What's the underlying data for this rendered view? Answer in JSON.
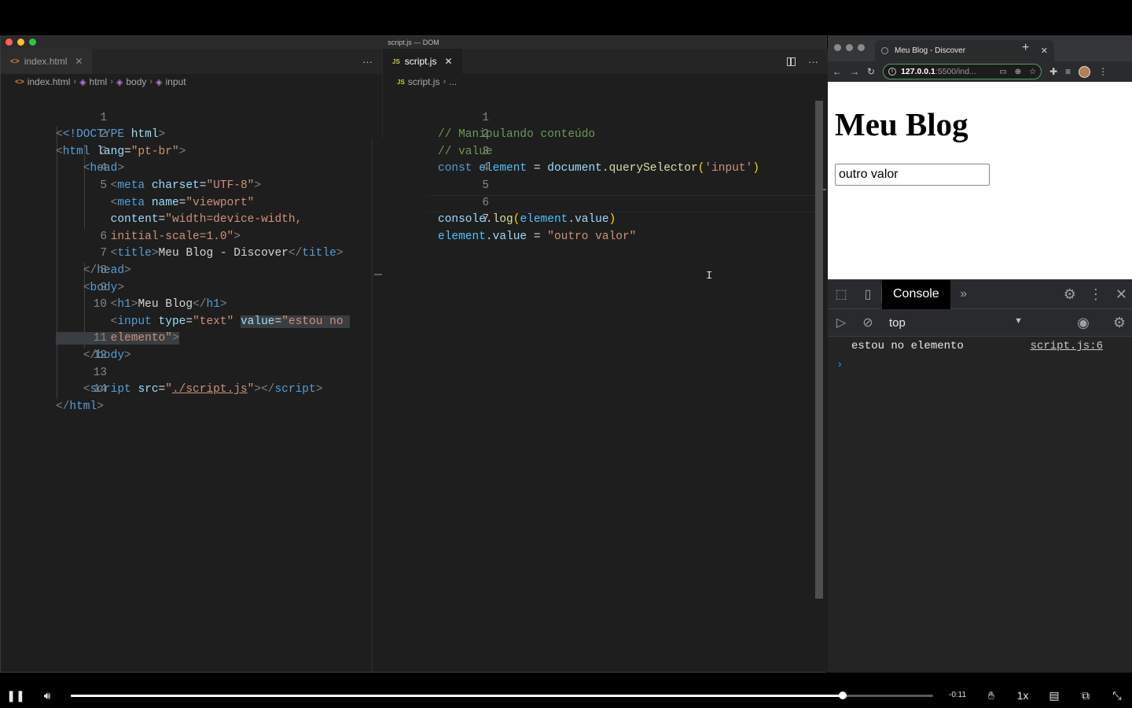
{
  "vscode": {
    "window_title": "script.js — DOM",
    "left": {
      "tab": {
        "icon": "<>",
        "label": "index.html"
      },
      "more": "···",
      "breadcrumb": [
        "index.html",
        "html",
        "body",
        "input"
      ],
      "lines": [
        {
          "n": "1"
        },
        {
          "n": "2"
        },
        {
          "n": "3"
        },
        {
          "n": "4"
        },
        {
          "n": "5"
        },
        {
          "n": ""
        },
        {
          "n": ""
        },
        {
          "n": "6"
        },
        {
          "n": "7"
        },
        {
          "n": "8"
        },
        {
          "n": "9"
        },
        {
          "n": "10"
        },
        {
          "n": ""
        },
        {
          "n": "11"
        },
        {
          "n": "12"
        },
        {
          "n": "13"
        },
        {
          "n": "14"
        }
      ],
      "code": {
        "doctype": "<!DOCTYPE",
        "html_word": "html",
        "gt": ">",
        "html_open": "html",
        "lang_attr": "lang",
        "lang_val": "\"pt-br\"",
        "head_open": "head",
        "meta": "meta",
        "charset_attr": "charset",
        "charset_val": "\"UTF-8\"",
        "name_attr": "name",
        "name_val": "\"viewport\"",
        "content_attr": "content",
        "content_val1": "\"width=device-width,",
        "content_val2": "initial-scale=1.0\"",
        "title": "title",
        "title_text": "Meu Blog - Discover",
        "head_close": "head",
        "body_open": "body",
        "h1": "h1",
        "h1_text": "Meu Blog",
        "input": "input",
        "type_attr": "type",
        "type_val": "\"text\"",
        "value_attr": "value",
        "value_val1": "\"estou no ",
        "value_val2": "elemento\"",
        "body_close": "body",
        "script": "script",
        "src_attr": "src",
        "src_val": "./script.js",
        "html_close": "html"
      }
    },
    "right": {
      "tab": {
        "icon": "JS",
        "label": "script.js"
      },
      "more": "···",
      "breadcrumb_file": "script.js",
      "breadcrumb_rest": "...",
      "lines": [
        "1",
        "2",
        "3",
        "4",
        "5",
        "6",
        "7"
      ],
      "code": {
        "c1": "// Manipulando conteúdo",
        "c2": "// value",
        "const": "const",
        "element": "element",
        "document": "document",
        "querySelector": "querySelector",
        "selector_arg": "'input'",
        "console": "console",
        "log": "log",
        "value": "value",
        "assign_val": "\"outro valor\""
      }
    }
  },
  "chrome": {
    "tab_title": "Meu Blog - Discover",
    "url_bold": "127.0.0.1",
    "url_rest": ":5500/ind...",
    "page": {
      "heading": "Meu Blog",
      "input_value": "outro valor"
    },
    "devtools": {
      "active_tab": "Console",
      "context": "top",
      "log_message": "estou no elemento",
      "log_source": "script.js:6"
    }
  },
  "video": {
    "time_remaining": "-0:11",
    "speed": "1x",
    "progress_percent": 89.5
  }
}
